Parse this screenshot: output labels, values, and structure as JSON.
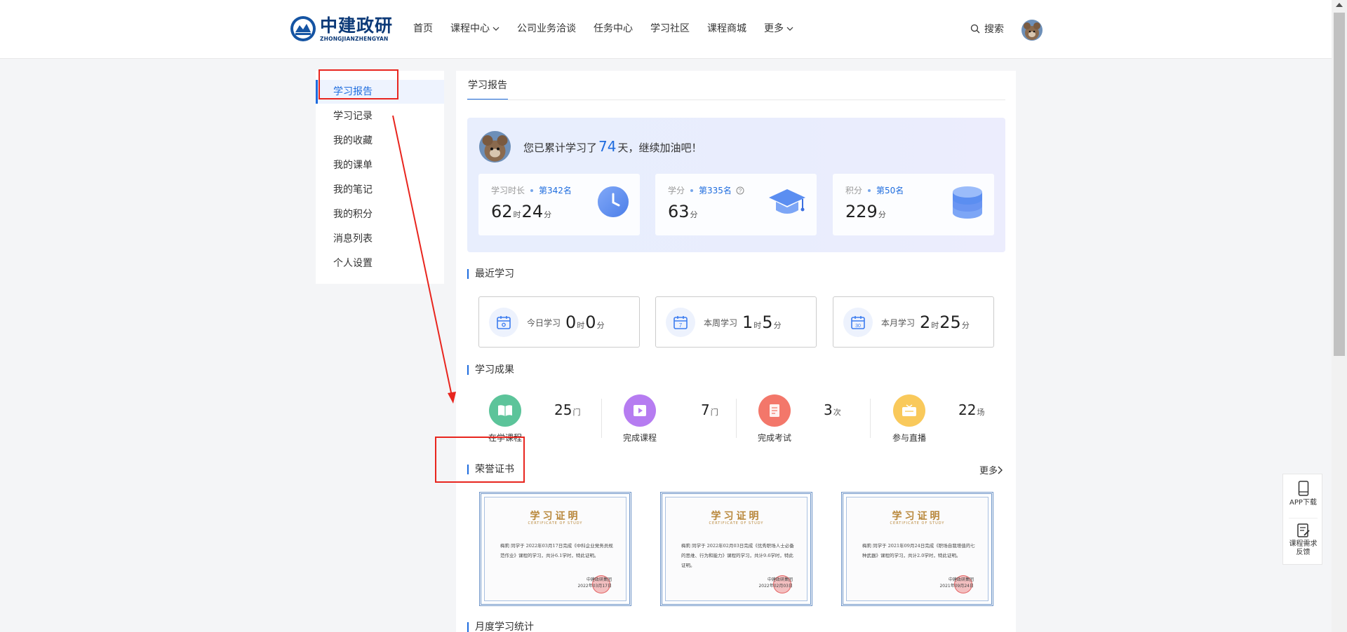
{
  "header": {
    "logo_cn": "中建政研",
    "logo_en": "ZHONGJIANZHENGYAN",
    "nav": [
      {
        "label": "首页",
        "dropdown": false
      },
      {
        "label": "课程中心",
        "dropdown": true
      },
      {
        "label": "公司业务洽谈",
        "dropdown": false
      },
      {
        "label": "任务中心",
        "dropdown": false
      },
      {
        "label": "学习社区",
        "dropdown": false
      },
      {
        "label": "课程商城",
        "dropdown": false
      },
      {
        "label": "更多",
        "dropdown": true
      }
    ],
    "search_label": "搜索"
  },
  "sidebar": {
    "items": [
      {
        "label": "学习报告",
        "active": true
      },
      {
        "label": "学习记录",
        "active": false
      },
      {
        "label": "我的收藏",
        "active": false
      },
      {
        "label": "我的课单",
        "active": false
      },
      {
        "label": "我的笔记",
        "active": false
      },
      {
        "label": "我的积分",
        "active": false
      },
      {
        "label": "消息列表",
        "active": false
      },
      {
        "label": "个人设置",
        "active": false
      }
    ]
  },
  "main": {
    "tab": "学习报告",
    "summary": {
      "prefix": "您已累计学习了",
      "days": "74",
      "suffix": "天，继续加油吧！"
    },
    "stats": [
      {
        "label": "学习时长",
        "rank": "第342名",
        "value": "62",
        "unit1": "时",
        "value2": "24",
        "unit2": "分",
        "icon": "clock-icon"
      },
      {
        "label": "学分",
        "rank": "第335名",
        "value": "63",
        "unit1": "分",
        "icon": "graduation-cap-icon",
        "help": true
      },
      {
        "label": "积分",
        "rank": "第50名",
        "value": "229",
        "unit1": "分",
        "icon": "coin-stack-icon"
      }
    ],
    "recent_title": "最近学习",
    "recent": [
      {
        "label": "今日学习",
        "h": "0",
        "hu": "时",
        "m": "0",
        "mu": "分",
        "day_num": "today"
      },
      {
        "label": "本周学习",
        "h": "1",
        "hu": "时",
        "m": "5",
        "mu": "分",
        "day_num": "7"
      },
      {
        "label": "本月学习",
        "h": "2",
        "hu": "时",
        "m": "25",
        "mu": "分",
        "day_num": "30"
      }
    ],
    "achievements_title": "学习成果",
    "achievements": [
      {
        "label": "在学课程",
        "value": "25",
        "unit": "门",
        "color": "#5cc49a"
      },
      {
        "label": "完成课程",
        "value": "7",
        "unit": "门",
        "color": "#b67cf1"
      },
      {
        "label": "完成考试",
        "value": "3",
        "unit": "次",
        "color": "#f3776a"
      },
      {
        "label": "参与直播",
        "value": "22",
        "unit": "场",
        "color": "#f9c95b"
      }
    ],
    "certs_title": "荣誉证书",
    "certs_more": "更多",
    "certificates": [
      {
        "title": "学习证明",
        "sub": "CERTIFICATE OF STUDY",
        "text": "梅莉 同学于 2022年03月17日完成《中科企业党务员规范作业》课程的学习，共计6.1学时，特此证明。",
        "issuer": "中建政研集团",
        "date": "2022年03月17日"
      },
      {
        "title": "学习证明",
        "sub": "CERTIFICATE OF STUDY",
        "text": "梅莉 同学于 2022年02月03日完成《优秀职场人士必备的思维、行为和能力》课程的学习，共计9.6学时，特此证明。",
        "issuer": "中建政研集团",
        "date": "2022年02月03日"
      },
      {
        "title": "学习证明",
        "sub": "CERTIFICATE OF STUDY",
        "text": "梅莉 同学于 2021年09月24日完成《职场自我增值的七种武器》课程的学习，共计2.0学时，特此证明。",
        "issuer": "中建政研集团",
        "date": "2021年09月24日"
      }
    ],
    "monthly_title": "月度学习统计"
  },
  "float_panel": {
    "app_download": "APP下载",
    "course_request": "课程需求反馈"
  },
  "colors": {
    "accent": "#1e6cde",
    "annotation_red": "#e8251e"
  }
}
